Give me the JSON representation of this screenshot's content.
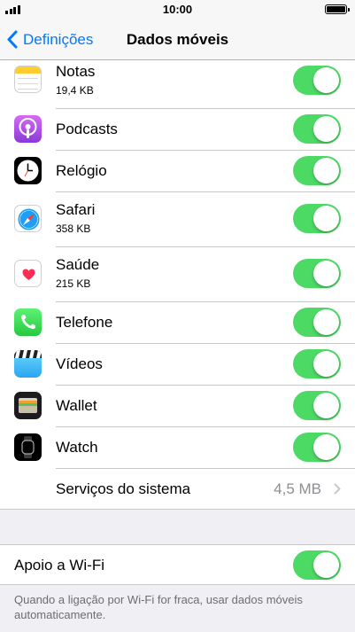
{
  "status_bar": {
    "time": "10:00"
  },
  "nav": {
    "back_label": "Definições",
    "title": "Dados móveis"
  },
  "apps": [
    {
      "name": "Notas",
      "size": "19,4 KB",
      "icon": "notes-icon",
      "enabled": true
    },
    {
      "name": "Podcasts",
      "size": "",
      "icon": "podcasts-icon",
      "enabled": true
    },
    {
      "name": "Relógio",
      "size": "",
      "icon": "clock-icon",
      "enabled": true
    },
    {
      "name": "Safari",
      "size": "358 KB",
      "icon": "safari-icon",
      "enabled": true
    },
    {
      "name": "Saúde",
      "size": "215 KB",
      "icon": "health-icon",
      "enabled": true
    },
    {
      "name": "Telefone",
      "size": "",
      "icon": "phone-icon",
      "enabled": true
    },
    {
      "name": "Vídeos",
      "size": "",
      "icon": "videos-icon",
      "enabled": true
    },
    {
      "name": "Wallet",
      "size": "",
      "icon": "wallet-icon",
      "enabled": true
    },
    {
      "name": "Watch",
      "size": "",
      "icon": "watch-icon",
      "enabled": true
    }
  ],
  "system_services": {
    "label": "Serviços do sistema",
    "value": "4,5 MB"
  },
  "wifi_assist": {
    "label": "Apoio a Wi-Fi",
    "enabled": true,
    "note": "Quando a ligação por Wi-Fi for fraca, usar dados móveis automaticamente."
  },
  "colors": {
    "accent": "#007aff",
    "toggle_on": "#4cd964",
    "background": "#efeff4"
  }
}
